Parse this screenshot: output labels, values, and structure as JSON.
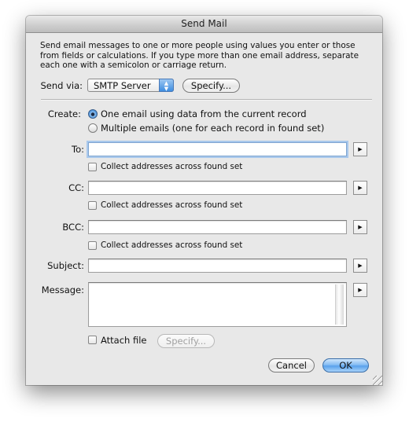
{
  "window": {
    "title": "Send Mail"
  },
  "description": "Send email messages to one or more people using values you enter or those from fields or calculations. If you type more than one email address, separate each one with a semicolon or carriage return.",
  "send_via": {
    "label": "Send via:",
    "selected": "SMTP Server",
    "specify_label": "Specify..."
  },
  "create": {
    "label": "Create:",
    "options": [
      {
        "label": "One email using data from the current record",
        "selected": true
      },
      {
        "label": "Multiple emails (one for each record in found set)",
        "selected": false
      }
    ]
  },
  "fields": {
    "to": {
      "label": "To:",
      "value": "",
      "collect_label": "Collect addresses across found set",
      "collect_checked": false
    },
    "cc": {
      "label": "CC:",
      "value": "",
      "collect_label": "Collect addresses across found set",
      "collect_checked": false
    },
    "bcc": {
      "label": "BCC:",
      "value": "",
      "collect_label": "Collect addresses across found set",
      "collect_checked": false
    },
    "subject": {
      "label": "Subject:",
      "value": ""
    },
    "message": {
      "label": "Message:",
      "value": ""
    }
  },
  "attach": {
    "label": "Attach file",
    "checked": false,
    "specify_label": "Specify..."
  },
  "buttons": {
    "cancel": "Cancel",
    "ok": "OK"
  },
  "icons": {
    "popup_arrows": "▲▼",
    "disclosure": "▶"
  }
}
